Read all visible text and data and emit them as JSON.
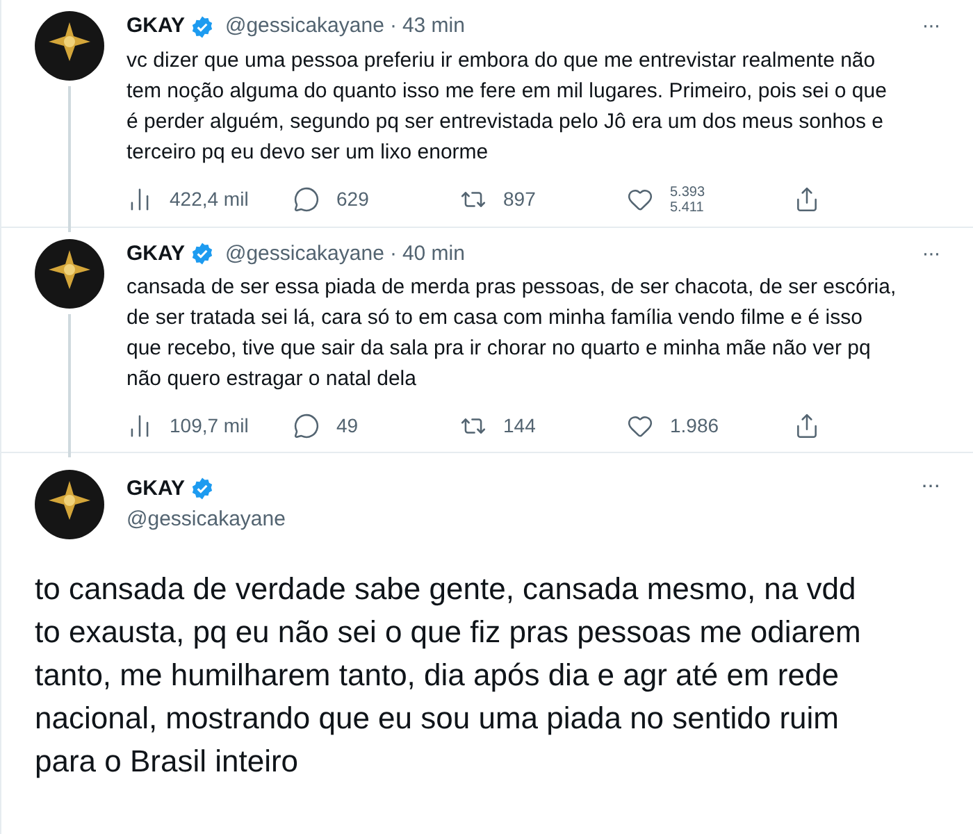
{
  "thread": [
    {
      "kind": "reply",
      "name": "GKAY",
      "verified": true,
      "handle": "@gessicakayane",
      "separator": "·",
      "time": "43 min",
      "more": "···",
      "text": "vc dizer que uma pessoa preferiu ir embora do que me entrevistar realmente não tem noção alguma do quanto isso me fere em mil lugares. Primeiro, pois sei o que é perder alguém, segundo pq ser entrevistada pelo Jô era um dos meus sonhos e terceiro pq eu devo ser um lixo enorme",
      "views": "422,4 mil",
      "replies": "629",
      "retweets": "897",
      "likes": [
        "5.393",
        "5.411"
      ]
    },
    {
      "kind": "reply",
      "name": "GKAY",
      "verified": true,
      "handle": "@gessicakayane",
      "separator": "·",
      "time": "40 min",
      "more": "···",
      "text": "cansada de ser essa piada de merda pras pessoas, de ser chacota, de ser escória, de ser tratada sei lá, cara só to em casa com minha família vendo filme e é isso que recebo, tive que sair da sala pra ir chorar no quarto e minha mãe não ver pq não quero estragar o natal dela",
      "views": "109,7 mil",
      "replies": "49",
      "retweets": "144",
      "likes": [
        "1.986"
      ]
    },
    {
      "kind": "main",
      "name": "GKAY",
      "verified": true,
      "handle": "@gessicakayane",
      "more": "···",
      "text": "to cansada de verdade sabe gente, cansada mesmo, na vdd to exausta, pq eu não sei o que fiz pras pessoas me odiarem tanto, me humilharem tanto, dia após dia e agr até em rede nacional, mostrando que eu sou uma piada no sentido ruim para o Brasil inteiro"
    }
  ]
}
